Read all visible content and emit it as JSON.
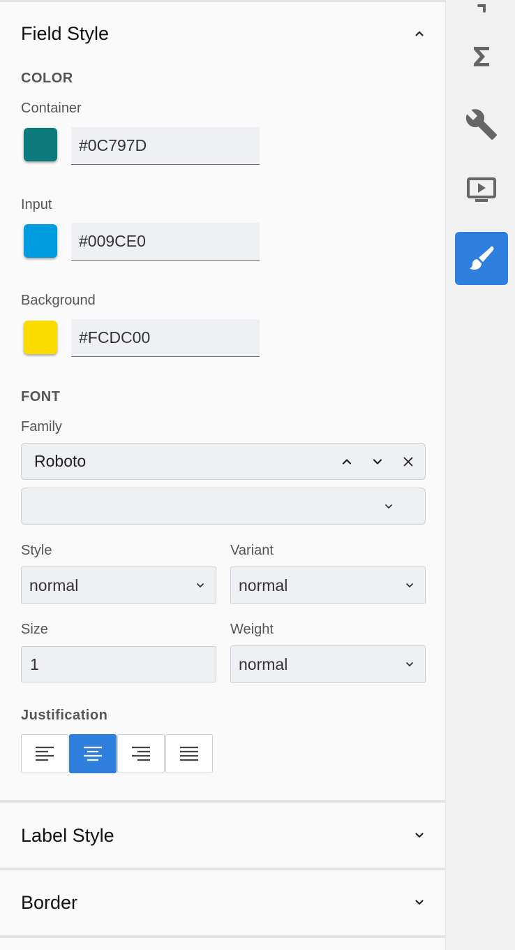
{
  "field_style": {
    "title": "Field Style",
    "color_group": "COLOR",
    "container": {
      "label": "Container",
      "color": "#0C797D",
      "hex": "#0C797D"
    },
    "input": {
      "label": "Input",
      "color": "#009CE0",
      "hex": "#009CE0"
    },
    "background": {
      "label": "Background",
      "color": "#FCDC00",
      "hex": "#FCDC00"
    },
    "font_group": "FONT",
    "family": {
      "label": "Family",
      "value": "Roboto",
      "secondary_value": ""
    },
    "style": {
      "label": "Style",
      "value": "normal"
    },
    "variant": {
      "label": "Variant",
      "value": "normal"
    },
    "size": {
      "label": "Size",
      "value": "1"
    },
    "weight": {
      "label": "Weight",
      "value": "normal"
    },
    "justification": {
      "label": "Justification",
      "options": [
        "align-left-icon",
        "align-center-icon",
        "align-right-icon",
        "align-justify-icon"
      ],
      "selected": "align-center-icon"
    }
  },
  "label_style": {
    "title": "Label Style"
  },
  "border": {
    "title": "Border"
  },
  "toolbar": {
    "items": [
      "sigma-icon",
      "wrench-icon",
      "preview-icon",
      "paintbrush-icon"
    ],
    "active": "paintbrush-icon",
    "active_color": "#2F80DE"
  }
}
